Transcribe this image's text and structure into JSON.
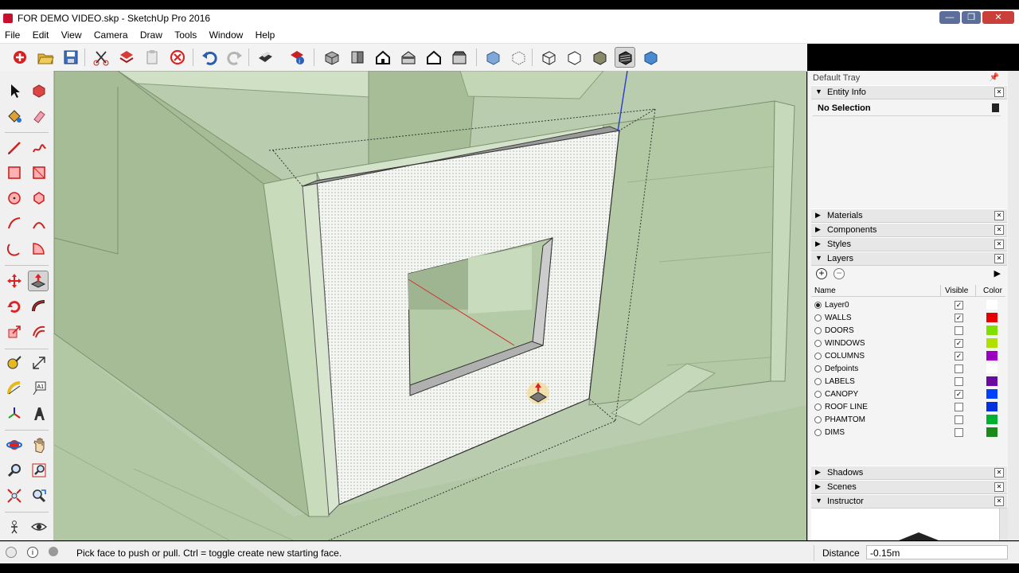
{
  "window": {
    "title": "FOR DEMO VIDEO.skp - SketchUp Pro 2016",
    "minimize": "—",
    "restore": "❐",
    "close": "✕"
  },
  "menu": [
    "File",
    "Edit",
    "View",
    "Camera",
    "Draw",
    "Tools",
    "Window",
    "Help"
  ],
  "toolbar_icons": [
    "get-started-icon",
    "open-icon",
    "save-icon",
    "cut-icon",
    "copy-icon",
    "paste-icon",
    "erase-icon",
    "undo-icon",
    "redo-icon",
    "print-icon",
    "model-info-icon",
    "iso-view-icon",
    "top-view-icon",
    "front-view-icon",
    "right-view-icon",
    "back-view-icon",
    "left-view-icon",
    "xray-icon",
    "back-edges-icon",
    "wireframe-icon",
    "hidden-line-icon",
    "shaded-icon",
    "shaded-textures-icon",
    "monochrome-icon"
  ],
  "tray": {
    "title": "Default Tray",
    "entity_info": {
      "label": "Entity Info",
      "selection": "No Selection"
    },
    "panels_top": [
      {
        "label": "Materials"
      },
      {
        "label": "Components"
      },
      {
        "label": "Styles"
      }
    ],
    "layers": {
      "label": "Layers",
      "headers": {
        "name": "Name",
        "visible": "Visible",
        "color": "Color"
      },
      "rows": [
        {
          "name": "Layer0",
          "active": true,
          "visible": true,
          "color": "#ffffff"
        },
        {
          "name": "WALLS",
          "active": false,
          "visible": true,
          "color": "#e60000"
        },
        {
          "name": "DOORS",
          "active": false,
          "visible": false,
          "color": "#7fe000"
        },
        {
          "name": "WINDOWS",
          "active": false,
          "visible": true,
          "color": "#b0e000"
        },
        {
          "name": "COLUMNS",
          "active": false,
          "visible": true,
          "color": "#9a00c0"
        },
        {
          "name": "Defpoints",
          "active": false,
          "visible": false,
          "color": "#ffffff"
        },
        {
          "name": "LABELS",
          "active": false,
          "visible": false,
          "color": "#6a0aa0"
        },
        {
          "name": "CANOPY",
          "active": false,
          "visible": true,
          "color": "#0040ff"
        },
        {
          "name": "ROOF LINE",
          "active": false,
          "visible": false,
          "color": "#0030e0"
        },
        {
          "name": "PHAMTOM",
          "active": false,
          "visible": false,
          "color": "#00b030"
        },
        {
          "name": "DIMS",
          "active": false,
          "visible": false,
          "color": "#1a8a1a"
        }
      ]
    },
    "panels_bottom": [
      {
        "label": "Shadows",
        "open": false
      },
      {
        "label": "Scenes",
        "open": false
      },
      {
        "label": "Instructor",
        "open": true
      }
    ]
  },
  "status": {
    "text": "Pick face to push or pull.  Ctrl = toggle create new starting face.",
    "distance_label": "Distance",
    "distance_value": "-0.15m"
  }
}
